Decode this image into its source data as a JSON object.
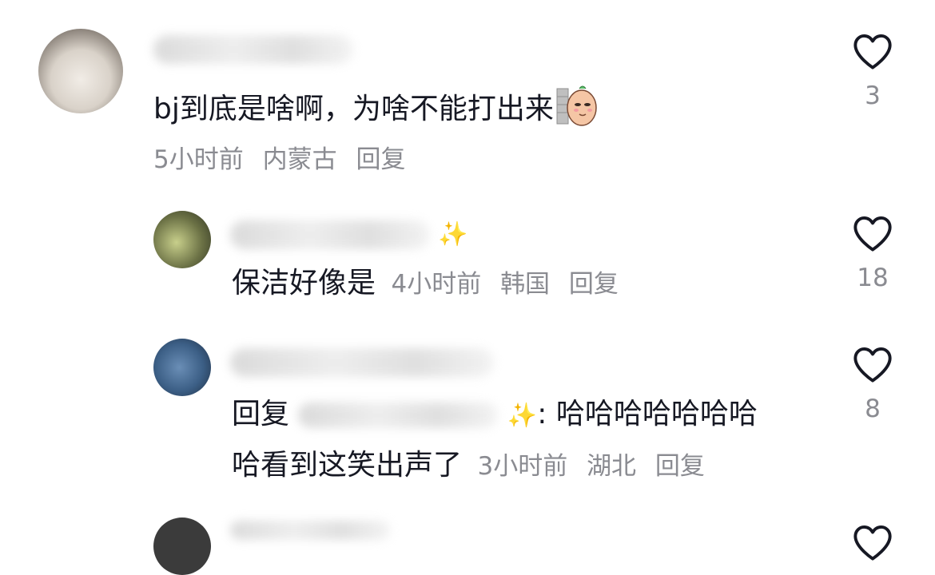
{
  "comments": [
    {
      "text": "bj到底是啥啊，为啥不能打出来",
      "emoji_name": "peeking-sticker-icon",
      "time": "5小时前",
      "location": "内蒙古",
      "reply_label": "回复",
      "likes": "3"
    },
    {
      "text": "保洁好像是",
      "time": "4小时前",
      "location": "韩国",
      "reply_label": "回复",
      "likes": "18"
    },
    {
      "reply_prefix": "回复",
      "sparkle": "✨",
      "text_line1": ": 哈哈哈哈哈哈哈",
      "text_line2": "哈看到这笑出声了",
      "time": "3小时前",
      "location": "湖北",
      "reply_label": "回复",
      "likes": "8"
    }
  ],
  "colors": {
    "text": "#161823",
    "meta": "#8a8b91",
    "heart": "#161823"
  }
}
